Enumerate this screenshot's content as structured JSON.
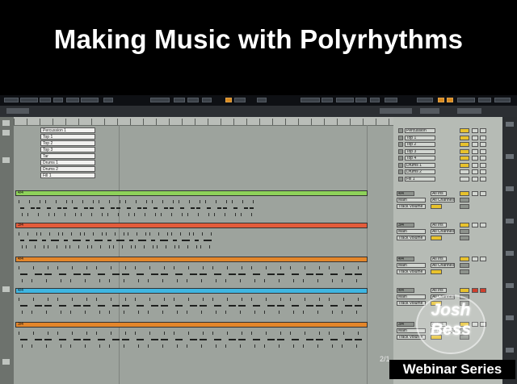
{
  "title": "Making Music with Polyrhythms",
  "clip_names": [
    "Percussion 1",
    "Top 1",
    "Top 2",
    "Top 3",
    "Tar",
    "Drums 1",
    "Drums 2",
    "Fill 1"
  ],
  "mixer_track_names": [
    "Percussion",
    "Top 1",
    "Top 2",
    "Top 3",
    "Top 4",
    "Drums 1",
    "Drums 2",
    "Fill 1"
  ],
  "lanes": [
    {
      "label": "4/4",
      "color": "#8ed25a"
    },
    {
      "label": "3/4",
      "color": "#e35c3b"
    },
    {
      "label": "4/4",
      "color": "#e4862a"
    },
    {
      "label": "4/4",
      "color": "#3fb6e2"
    },
    {
      "label": "3/4",
      "color": "#e4862a"
    }
  ],
  "mixer_groups": [
    {
      "sig": "4/4",
      "input": "All Ins",
      "monitor": "Main",
      "channel": "All Channels",
      "volume": "Track Volume"
    },
    {
      "sig": "3/4",
      "input": "All Ins",
      "monitor": "Main",
      "channel": "All Channels",
      "volume": "Track Volume"
    },
    {
      "sig": "4/4",
      "input": "All Ins",
      "monitor": "Main",
      "channel": "All Channels",
      "volume": "Track Volume"
    },
    {
      "sig": "4/4",
      "input": "All Ins",
      "monitor": "Main",
      "channel": "All Channels",
      "volume": "Track Volume"
    },
    {
      "sig": "3/4",
      "input": "All Ins",
      "monitor": "Main",
      "channel": "All Channels",
      "volume": "Track Volume"
    }
  ],
  "tempo_readout": "2/1",
  "logo": {
    "line1": "Josh",
    "line2": "Bess"
  },
  "webinar_label": "Webinar Series"
}
